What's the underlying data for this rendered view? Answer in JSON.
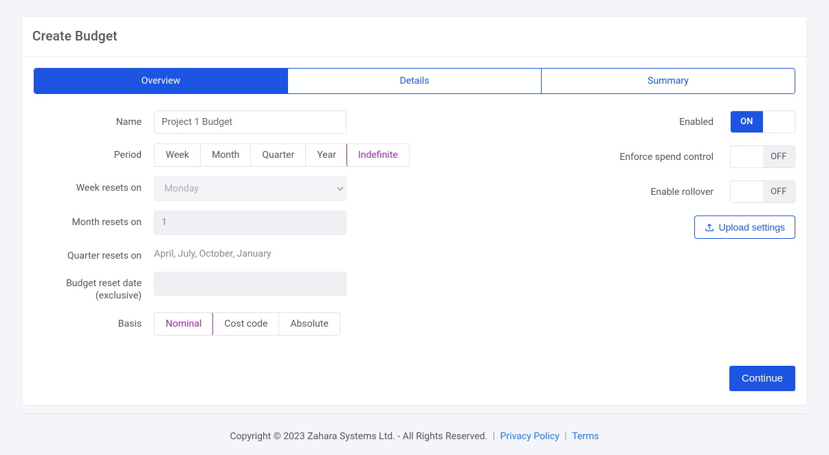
{
  "header": {
    "title": "Create Budget"
  },
  "tabs": {
    "overview": "Overview",
    "details": "Details",
    "summary": "Summary"
  },
  "form": {
    "name_label": "Name",
    "name_value": "Project 1 Budget",
    "period_label": "Period",
    "period_options": {
      "week": "Week",
      "month": "Month",
      "quarter": "Quarter",
      "year": "Year",
      "indefinite": "Indefinite"
    },
    "week_resets_label": "Week resets on",
    "week_resets_value": "Monday",
    "month_resets_label": "Month resets on",
    "month_resets_value": "1",
    "quarter_resets_label": "Quarter resets on",
    "quarter_resets_value": "April, July, October, January",
    "budget_reset_label": "Budget reset date (exclusive)",
    "budget_reset_value": "",
    "basis_label": "Basis",
    "basis_options": {
      "nominal": "Nominal",
      "cost_code": "Cost code",
      "absolute": "Absolute"
    }
  },
  "toggles": {
    "enabled_label": "Enabled",
    "enforce_label": "Enforce spend control",
    "rollover_label": "Enable rollover",
    "on_text": "ON",
    "off_text": "OFF"
  },
  "buttons": {
    "upload_settings": "Upload settings",
    "continue": "Continue"
  },
  "footer": {
    "copyright": "Copyright © 2023 Zahara Systems Ltd. - All Rights Reserved. ",
    "privacy": "Privacy Policy",
    "terms": "Terms",
    "sep": " | "
  }
}
